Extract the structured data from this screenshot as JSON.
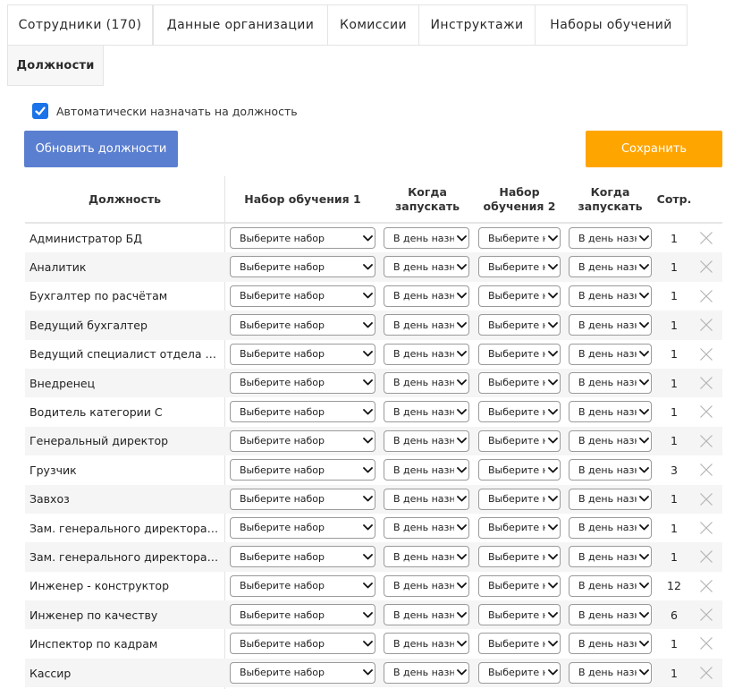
{
  "tabs": [
    {
      "label": "Сотрудники (170)"
    },
    {
      "label": "Данные организации"
    },
    {
      "label": "Комиссии"
    },
    {
      "label": "Инструктажи"
    },
    {
      "label": "Наборы обучений"
    },
    {
      "label": "Должности",
      "active": true
    }
  ],
  "auto_assign": {
    "label": "Автоматически назначать на должность",
    "checked": true
  },
  "buttons": {
    "update": "Обновить должности",
    "save": "Сохранить"
  },
  "colors": {
    "update": "#5b7fd0",
    "save": "#ffa500",
    "checkbox": "#1a73e8"
  },
  "table": {
    "headers": {
      "position": "Должность",
      "set1": "Набор обучения 1",
      "when1_a": "Когда",
      "when1_b": "запускать",
      "set2_a": "Набор",
      "set2_b": "обучения 2",
      "when2_a": "Когда",
      "when2_b": "запускать",
      "count": "Сотр."
    },
    "select_set_placeholder": "Выберите набор",
    "select_when_value": "В день назначения",
    "rows": [
      {
        "name": "Администратор БД",
        "count": "1"
      },
      {
        "name": "Аналитик",
        "count": "1"
      },
      {
        "name": "Бухгалтер по расчётам",
        "count": "1"
      },
      {
        "name": "Ведущий бухгалтер",
        "count": "1"
      },
      {
        "name": "Ведущий специалист отдела по О...",
        "count": "1"
      },
      {
        "name": "Внедренец",
        "count": "1"
      },
      {
        "name": "Водитель категории С",
        "count": "1"
      },
      {
        "name": "Генеральный директор",
        "count": "1"
      },
      {
        "name": "Грузчик",
        "count": "3"
      },
      {
        "name": "Завхоз",
        "count": "1"
      },
      {
        "name": "Зам. генерального директора по ...",
        "count": "1"
      },
      {
        "name": "Зам. генерального директора по ...",
        "count": "1"
      },
      {
        "name": "Инженер - конструктор",
        "count": "12"
      },
      {
        "name": "Инженер по качеству",
        "count": "6"
      },
      {
        "name": "Инспектор по кадрам",
        "count": "1"
      },
      {
        "name": "Кассир",
        "count": "1"
      }
    ]
  }
}
